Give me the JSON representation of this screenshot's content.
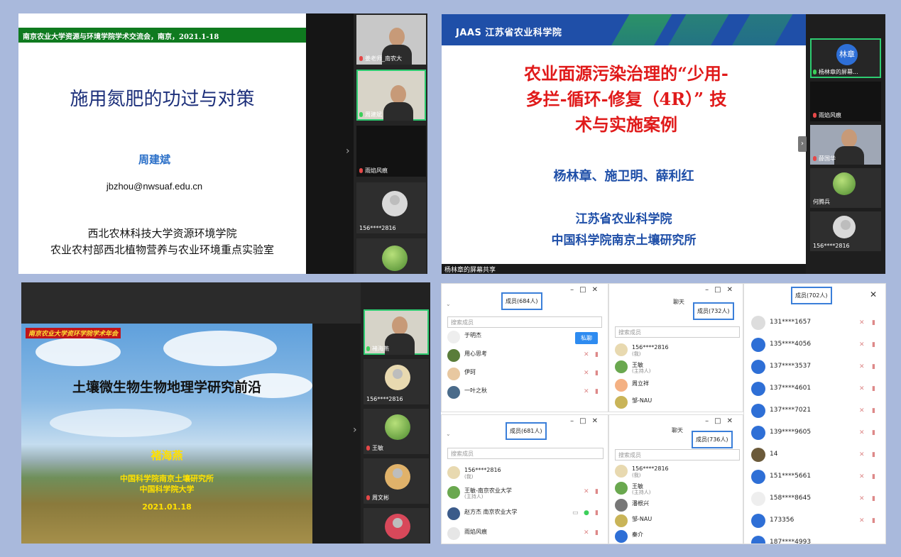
{
  "panel1": {
    "banner": "南京农业大学资源与环境学院学术交流会，南京，2021.1-18",
    "title": "施用氮肥的功过与对策",
    "author": "周建斌",
    "email": "jbzhou@nwsuaf.edu.cn",
    "inst1": "西北农林科技大学资源环境学院",
    "inst2": "农业农村部西北植物营养与农业环境重点实验室",
    "tiles": [
      "姜老师_南农大",
      "周建斌",
      "雨焰风痕",
      "156****2816"
    ]
  },
  "panel2": {
    "logo": "JAAS 江苏省农业科学院",
    "title_l1": "农业面源污染治理的“少用-",
    "title_l2": "多拦-循环-修复（4R）” 技",
    "title_l3": "术与实施案例",
    "names": "杨林章、施卫明、薛利红",
    "org1": "江苏省农业科学院",
    "org2": "中国科学院南京土壤研究所",
    "share": "杨林章的屏幕共享",
    "tiles": [
      "杨林章的屏幕...",
      "雨焰风痕",
      "薛国华",
      "何腾兵",
      "156****2816"
    ],
    "avatar_text": "林章"
  },
  "panel3": {
    "banner": "南京农业大学资环学院学术年会",
    "title": "土壤微生物生物地理学研究前沿",
    "author": "褚海燕",
    "inst1": "中国科学院南京土壤研究所",
    "inst2": "中国科学院大学",
    "date": "2021.01.18",
    "tiles": [
      "褚海燕",
      "156****2816",
      "王敏",
      "周文彬"
    ]
  },
  "panel4": {
    "w1": {
      "count": "成员(684人)",
      "search": "搜索成员",
      "members": [
        "于明杰",
        "用心思考",
        "伊珂",
        "一叶之秋"
      ],
      "msg_btn": "私聊"
    },
    "w2": {
      "chat": "聊天",
      "count": "成员(732人)",
      "search": "搜索成员",
      "members": [
        {
          "name": "156****2816",
          "sub": "(我)"
        },
        {
          "name": "王敏",
          "sub": "(主持人)"
        },
        {
          "name": "周立祥",
          "sub": ""
        },
        {
          "name": "邹-NAU",
          "sub": ""
        }
      ]
    },
    "w3": {
      "count": "成员(681人)",
      "search": "搜索成员",
      "members": [
        {
          "name": "156****2816",
          "sub": "(我)"
        },
        {
          "name": "王敏-南京农业大学",
          "sub": "(主持人)"
        },
        {
          "name": "赵方杰 南京农业大学",
          "sub": ""
        },
        {
          "name": "雨焰风痕",
          "sub": ""
        }
      ]
    },
    "w4": {
      "chat": "聊天",
      "count": "成员(736人)",
      "search": "搜索成员",
      "members": [
        {
          "name": "156****2816",
          "sub": "(我)"
        },
        {
          "name": "王敏",
          "sub": "(主持人)"
        },
        {
          "name": "潘根兴",
          "sub": ""
        },
        {
          "name": "邹-NAU",
          "sub": ""
        },
        {
          "name": "秦介",
          "sub": ""
        }
      ]
    },
    "w5": {
      "count": "成员(702人)",
      "members": [
        "131****1657",
        "135****4056",
        "137****3537",
        "137****4601",
        "137****7021",
        "139****9605",
        "14",
        "151****5661",
        "158****8645",
        "173356",
        "187****4993"
      ]
    }
  }
}
